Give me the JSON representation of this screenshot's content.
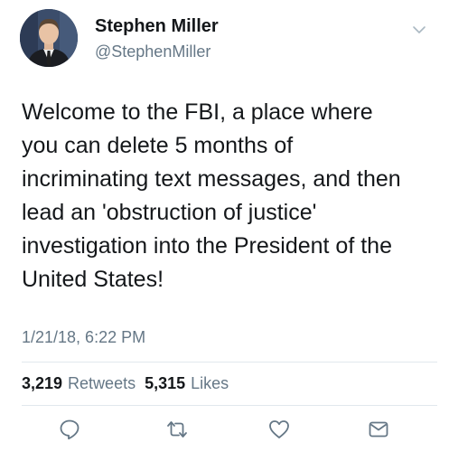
{
  "user": {
    "name": "Stephen Miller",
    "handle": "@StephenMiller"
  },
  "tweet": {
    "text": "Welcome to the FBI, a place where\nyou can delete 5 months of\nincriminating text messages, and then\nlead an 'obstruction of justice'\ninvestigation into the President of the\nUnited States!",
    "timestamp": "1/21/18, 6:22 PM"
  },
  "stats": {
    "retweets_count": "3,219",
    "retweets_label": "Retweets",
    "likes_count": "5,315",
    "likes_label": "Likes"
  },
  "icons": {
    "more": "chevron-down-icon",
    "reply": "reply-icon",
    "retweet": "retweet-icon",
    "like": "heart-icon",
    "dm": "direct-message-icon"
  },
  "colors": {
    "text": "#14171a",
    "secondary": "#657786",
    "divider": "#e1e8ed"
  }
}
